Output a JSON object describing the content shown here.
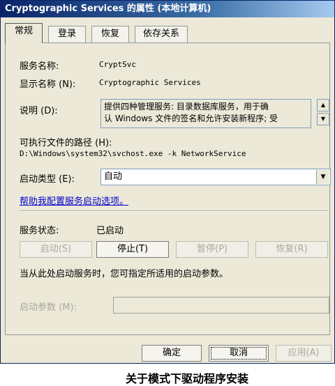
{
  "window": {
    "title": "Cryptographic Services 的属性 (本地计算机)"
  },
  "tabs": [
    {
      "label": "常规"
    },
    {
      "label": "登录"
    },
    {
      "label": "恢复"
    },
    {
      "label": "依存关系"
    }
  ],
  "general": {
    "service_name_label": "服务名称:",
    "service_name_value": "CryptSvc",
    "display_name_label": "显示名称 (N):",
    "display_name_value": "Cryptographic Services",
    "description_label": "说明 (D):",
    "description_line1": "提供四种管理服务: 目录数据库服务，用于确",
    "description_line2": "认 Windows 文件的签名和允许安装新程序; 受",
    "exe_path_label": "可执行文件的路径 (H):",
    "exe_path_value": "D:\\Windows\\system32\\svchost.exe -k NetworkService",
    "startup_type_label": "启动类型 (E):",
    "startup_type_value": "自动",
    "help_link": "帮助我配置服务启动选项。",
    "service_status_label": "服务状态:",
    "service_status_value": "已启动",
    "buttons": {
      "start": "启动(S)",
      "stop": "停止(T)",
      "pause": "暂停(P)",
      "resume": "恢复(R)"
    },
    "start_params_note": "当从此处启动服务时，您可指定所适用的启动参数。",
    "start_params_label": "启动参数 (M):"
  },
  "footer": {
    "ok": "确定",
    "cancel": "取消",
    "apply": "应用(A)"
  },
  "caption": "关于模式下驱动程序安装"
}
